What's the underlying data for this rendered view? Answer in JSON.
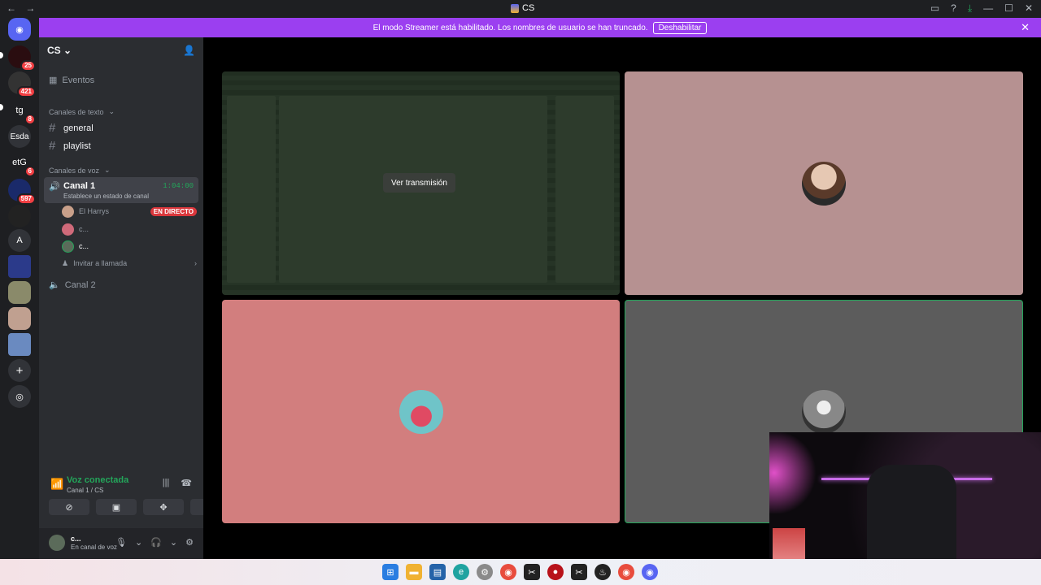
{
  "window": {
    "title": "CS",
    "nav_back": "←",
    "nav_fwd": "→",
    "icons": [
      "inbox-icon",
      "help-icon",
      "download-icon",
      "minimize-icon",
      "maximize-icon",
      "close-icon"
    ]
  },
  "banner": {
    "text": "El modo Streamer está habilitado. Los nombres de usuario se han truncado.",
    "button": "Deshabilitar",
    "close": "✕"
  },
  "servers": [
    {
      "label": "",
      "badge": "25"
    },
    {
      "label": "",
      "badge": "421"
    },
    {
      "label": "tg",
      "badge": "8"
    },
    {
      "label": "Esda",
      "badge": ""
    },
    {
      "label": "etG",
      "badge": "6"
    },
    {
      "label": "",
      "badge": "597"
    },
    {
      "label": "",
      "badge": ""
    },
    {
      "label": "A",
      "badge": ""
    }
  ],
  "guild": {
    "name": "CS",
    "events": "Eventos"
  },
  "categories": {
    "text": "Canales de texto",
    "voice": "Canales de voz"
  },
  "text_channels": [
    "general",
    "playlist"
  ],
  "voice_channels": {
    "active": {
      "name": "Canal 1",
      "time": "1:04:00",
      "status": "Establece un estado de canal"
    },
    "members": [
      {
        "name": "El Harrys",
        "live": "EN DIRECTO"
      },
      {
        "name": "c...",
        "live": ""
      },
      {
        "name": "c...",
        "live": ""
      }
    ],
    "invite": "Invitar a llamada",
    "other": "Canal 2"
  },
  "voice_panel": {
    "title": "Voz conectada",
    "subtitle": "Canal 1 / CS"
  },
  "user_panel": {
    "name": "c...",
    "status": "En canal de voz"
  },
  "stage": {
    "view_stream": "Ver transmisión"
  },
  "colors": {
    "accent": "#23a55a",
    "banner": "#9b3ff0",
    "live": "#da373c"
  }
}
